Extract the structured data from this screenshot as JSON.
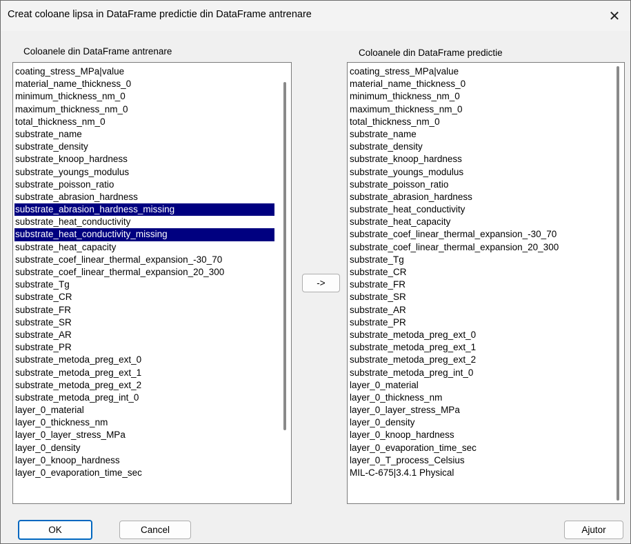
{
  "window": {
    "title": "Creat coloane lipsa in DataFrame predictie din DataFrame antrenare",
    "close_glyph": "✕"
  },
  "left_panel": {
    "label": "Coloanele din DataFrame antrenare",
    "items": [
      {
        "text": "coating_stress_MPa|value",
        "selected": false
      },
      {
        "text": "material_name_thickness_0",
        "selected": false
      },
      {
        "text": "minimum_thickness_nm_0",
        "selected": false
      },
      {
        "text": "maximum_thickness_nm_0",
        "selected": false
      },
      {
        "text": "total_thickness_nm_0",
        "selected": false
      },
      {
        "text": "substrate_name",
        "selected": false
      },
      {
        "text": "substrate_density",
        "selected": false
      },
      {
        "text": "substrate_knoop_hardness",
        "selected": false
      },
      {
        "text": "substrate_youngs_modulus",
        "selected": false
      },
      {
        "text": "substrate_poisson_ratio",
        "selected": false
      },
      {
        "text": "substrate_abrasion_hardness",
        "selected": false
      },
      {
        "text": "substrate_abrasion_hardness_missing",
        "selected": true
      },
      {
        "text": "substrate_heat_conductivity",
        "selected": false
      },
      {
        "text": "substrate_heat_conductivity_missing",
        "selected": true
      },
      {
        "text": "substrate_heat_capacity",
        "selected": false
      },
      {
        "text": "substrate_coef_linear_thermal_expansion_-30_70",
        "selected": false
      },
      {
        "text": "substrate_coef_linear_thermal_expansion_20_300",
        "selected": false
      },
      {
        "text": "substrate_Tg",
        "selected": false
      },
      {
        "text": "substrate_CR",
        "selected": false
      },
      {
        "text": "substrate_FR",
        "selected": false
      },
      {
        "text": "substrate_SR",
        "selected": false
      },
      {
        "text": "substrate_AR",
        "selected": false
      },
      {
        "text": "substrate_PR",
        "selected": false
      },
      {
        "text": "substrate_metoda_preg_ext_0",
        "selected": false
      },
      {
        "text": "substrate_metoda_preg_ext_1",
        "selected": false
      },
      {
        "text": "substrate_metoda_preg_ext_2",
        "selected": false
      },
      {
        "text": "substrate_metoda_preg_int_0",
        "selected": false
      },
      {
        "text": "layer_0_material",
        "selected": false
      },
      {
        "text": "layer_0_thickness_nm",
        "selected": false
      },
      {
        "text": "layer_0_layer_stress_MPa",
        "selected": false
      },
      {
        "text": "layer_0_density",
        "selected": false
      },
      {
        "text": "layer_0_knoop_hardness",
        "selected": false
      },
      {
        "text": "layer_0_evaporation_time_sec",
        "selected": false
      }
    ]
  },
  "right_panel": {
    "label": "Coloanele din DataFrame predictie",
    "items": [
      {
        "text": "coating_stress_MPa|value",
        "selected": false
      },
      {
        "text": "material_name_thickness_0",
        "selected": false
      },
      {
        "text": "minimum_thickness_nm_0",
        "selected": false
      },
      {
        "text": "maximum_thickness_nm_0",
        "selected": false
      },
      {
        "text": "total_thickness_nm_0",
        "selected": false
      },
      {
        "text": "substrate_name",
        "selected": false
      },
      {
        "text": "substrate_density",
        "selected": false
      },
      {
        "text": "substrate_knoop_hardness",
        "selected": false
      },
      {
        "text": "substrate_youngs_modulus",
        "selected": false
      },
      {
        "text": "substrate_poisson_ratio",
        "selected": false
      },
      {
        "text": "substrate_abrasion_hardness",
        "selected": false
      },
      {
        "text": "substrate_heat_conductivity",
        "selected": false
      },
      {
        "text": "substrate_heat_capacity",
        "selected": false
      },
      {
        "text": "substrate_coef_linear_thermal_expansion_-30_70",
        "selected": false
      },
      {
        "text": "substrate_coef_linear_thermal_expansion_20_300",
        "selected": false
      },
      {
        "text": "substrate_Tg",
        "selected": false
      },
      {
        "text": "substrate_CR",
        "selected": false
      },
      {
        "text": "substrate_FR",
        "selected": false
      },
      {
        "text": "substrate_SR",
        "selected": false
      },
      {
        "text": "substrate_AR",
        "selected": false
      },
      {
        "text": "substrate_PR",
        "selected": false
      },
      {
        "text": "substrate_metoda_preg_ext_0",
        "selected": false
      },
      {
        "text": "substrate_metoda_preg_ext_1",
        "selected": false
      },
      {
        "text": "substrate_metoda_preg_ext_2",
        "selected": false
      },
      {
        "text": "substrate_metoda_preg_int_0",
        "selected": false
      },
      {
        "text": "layer_0_material",
        "selected": false
      },
      {
        "text": "layer_0_thickness_nm",
        "selected": false
      },
      {
        "text": "layer_0_layer_stress_MPa",
        "selected": false
      },
      {
        "text": "layer_0_density",
        "selected": false
      },
      {
        "text": "layer_0_knoop_hardness",
        "selected": false
      },
      {
        "text": "layer_0_evaporation_time_sec",
        "selected": false
      },
      {
        "text": "layer_0_T_process_Celsius",
        "selected": false
      },
      {
        "text": "MIL-C-675|3.4.1 Physical",
        "selected": false
      }
    ]
  },
  "transfer_button": {
    "label": "->"
  },
  "buttons": {
    "ok": "OK",
    "cancel": "Cancel",
    "help": "Ajutor"
  },
  "colors": {
    "selection_bg": "#000080",
    "default_button_border": "#0067c0"
  }
}
